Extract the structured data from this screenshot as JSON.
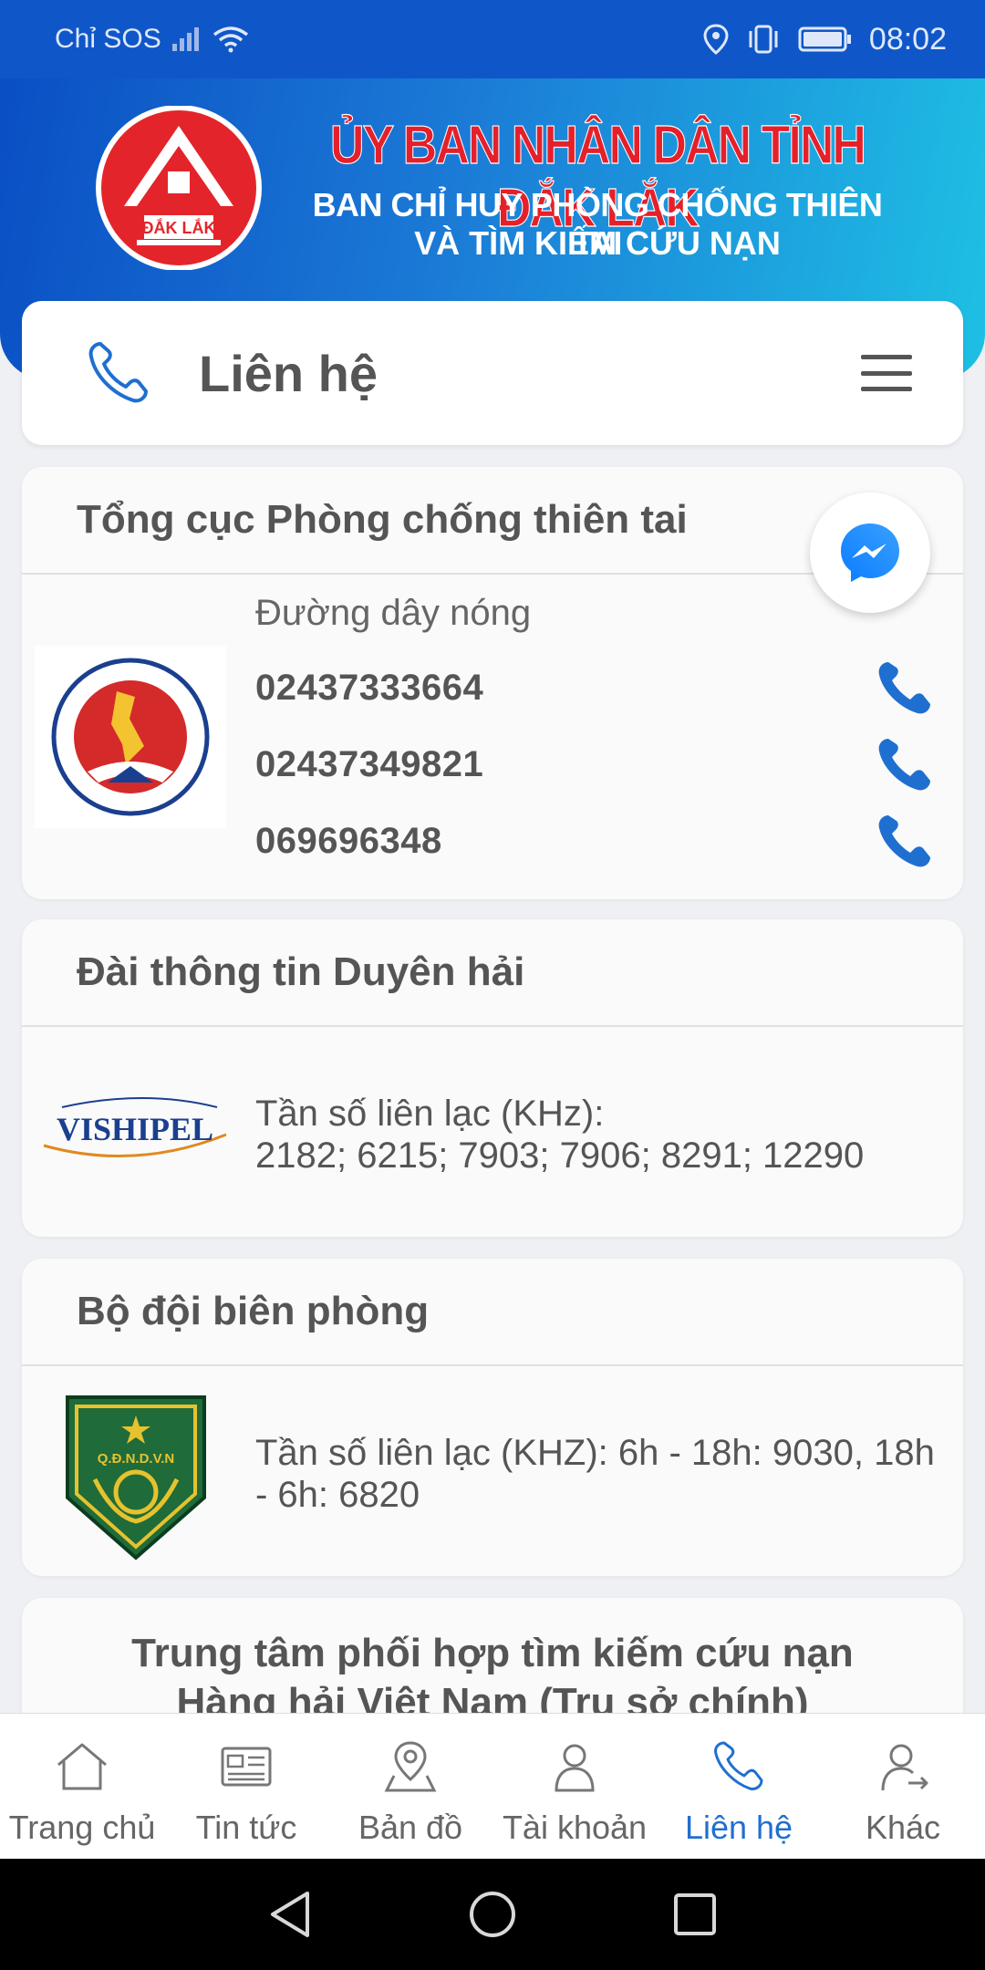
{
  "status_bar": {
    "carrier": "Chỉ SOS",
    "time": "08:02"
  },
  "banner": {
    "logo_text": "ĐẮK LẮK",
    "title_line1": "ỦY BAN NHÂN DÂN TỈNH ĐẮK LẮK",
    "title_line2": "BAN CHỈ HUY PHÒNG CHỐNG THIÊN TAI",
    "title_line3": "VÀ TÌM KIẾM CỨU NẠN"
  },
  "header": {
    "title": "Liên hệ"
  },
  "cards": [
    {
      "title": "Tổng cục Phòng chống thiên tai",
      "hotline_label": "Đường dây nóng",
      "phones": [
        "02437333664",
        "02437349821",
        "069696348"
      ]
    },
    {
      "title": "Đài thông tin Duyên hải",
      "logo_text": "VISHIPEL",
      "info_line1": "Tần số liên lạc (KHz):",
      "info_line2": "2182; 6215; 7903; 7906; 8291; 12290"
    },
    {
      "title": "Bộ đội biên phòng",
      "logo_text": "Q.Đ.N.D.V.N",
      "info_line1": "Tần số liên lạc (KHZ): 6h - 18h: 9030, 18h",
      "info_line2": "- 6h: 6820"
    },
    {
      "title_line1": "Trung tâm phối hợp tìm kiếm cứu nạn",
      "title_line2": "Hàng hải Việt Nam (Trụ sở chính)"
    }
  ],
  "bottom_nav": [
    {
      "label": "Trang chủ",
      "icon": "home-icon"
    },
    {
      "label": "Tin tức",
      "icon": "news-icon"
    },
    {
      "label": "Bản đồ",
      "icon": "map-pin-icon"
    },
    {
      "label": "Tài khoản",
      "icon": "user-icon"
    },
    {
      "label": "Liên hệ",
      "icon": "phone-icon",
      "active": true
    },
    {
      "label": "Khác",
      "icon": "user-switch-icon"
    }
  ],
  "colors": {
    "status_bar": "#0f57c8",
    "accent": "#1f6fd1",
    "banner_red": "#e5202a"
  }
}
